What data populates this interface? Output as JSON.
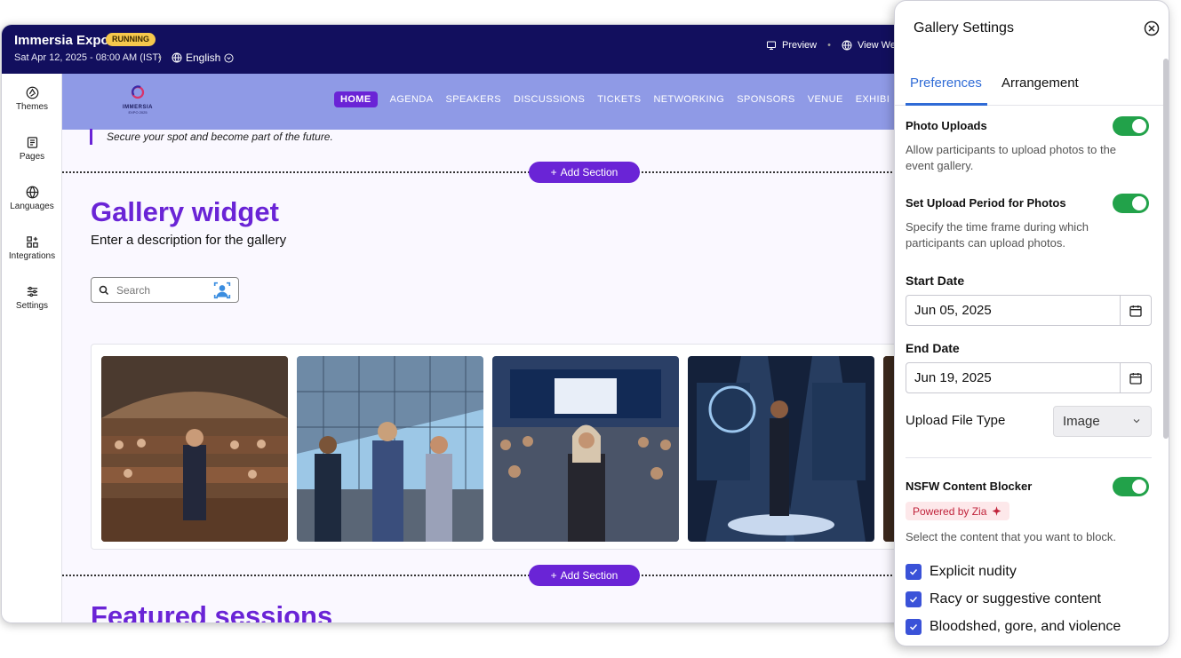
{
  "topbar": {
    "event_title": "Immersia Expo",
    "status_badge": "RUNNING",
    "event_date": "Sat Apr 12, 2025 - 08:00 AM (IST)",
    "language": "English",
    "preview_label": "Preview",
    "view_website_label": "View Wel"
  },
  "sidebar": {
    "items": [
      {
        "label": "Themes",
        "icon": "palette-icon"
      },
      {
        "label": "Pages",
        "icon": "pages-icon"
      },
      {
        "label": "Languages",
        "icon": "globe-icon"
      },
      {
        "label": "Integrations",
        "icon": "integrations-icon"
      },
      {
        "label": "Settings",
        "icon": "sliders-icon"
      }
    ]
  },
  "site": {
    "logo_text": "IMMERSIA",
    "logo_sub": "EXPO 2025",
    "nav": [
      "HOME",
      "AGENDA",
      "SPEAKERS",
      "DISCUSSIONS",
      "TICKETS",
      "NETWORKING",
      "SPONSORS",
      "VENUE",
      "EXHIBI"
    ],
    "active_nav": "HOME",
    "quote": "Secure your spot and become part of the future.",
    "add_section_label": "Add Section",
    "gallery_title": "Gallery widget",
    "gallery_description": "Enter a description for the gallery",
    "search_placeholder": "Search",
    "featured_title": "Featured sessions"
  },
  "panel": {
    "title": "Gallery Settings",
    "tabs": [
      "Preferences",
      "Arrangement"
    ],
    "active_tab": "Preferences",
    "photo_uploads": {
      "label": "Photo Uploads",
      "description": "Allow participants to upload photos to the event gallery.",
      "enabled": true
    },
    "upload_period": {
      "label": "Set Upload Period for Photos",
      "description": "Specify the time frame during which participants can upload photos.",
      "enabled": true
    },
    "start_date": {
      "label": "Start Date",
      "value": "Jun 05, 2025"
    },
    "end_date": {
      "label": "End Date",
      "value": "Jun 19, 2025"
    },
    "file_type": {
      "label": "Upload File Type",
      "value": "Image"
    },
    "nsfw": {
      "label": "NSFW Content Blocker",
      "enabled": true,
      "zia_badge": "Powered by Zia",
      "description": "Select the content that you want to block.",
      "options": [
        {
          "label": "Explicit nudity",
          "checked": true
        },
        {
          "label": "Racy or suggestive content",
          "checked": true
        },
        {
          "label": "Bloodshed, gore, and violence",
          "checked": true
        }
      ]
    }
  },
  "colors": {
    "topbar": "#120f5e",
    "accent_purple": "#6a24d6",
    "nav_bg": "#8f9ae6",
    "toggle_green": "#22a24a",
    "tab_blue": "#2f6bd6",
    "checkbox_blue": "#3a52d8"
  }
}
